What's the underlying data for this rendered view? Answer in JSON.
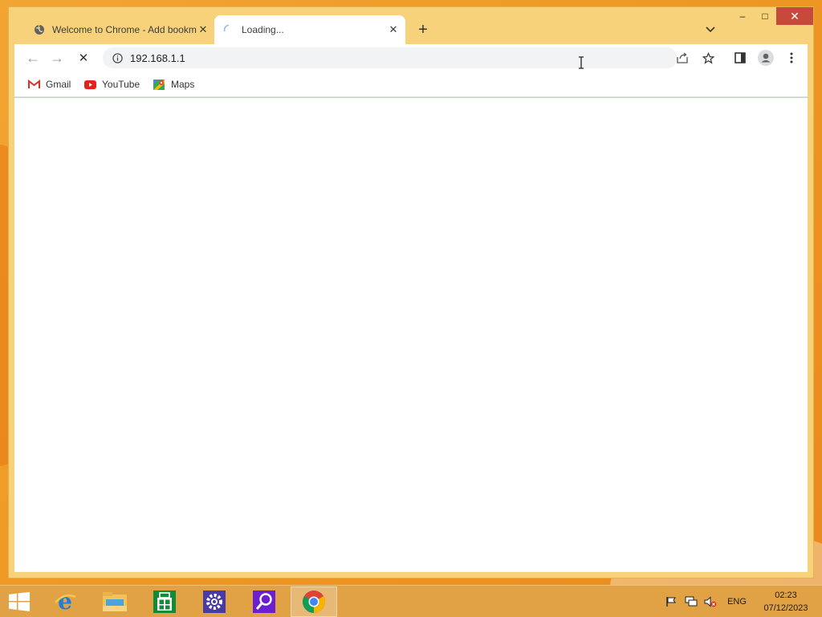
{
  "browser": {
    "tabs": [
      {
        "title": "Welcome to Chrome - Add bookmarks",
        "active": false,
        "favicon": "globe-icon"
      },
      {
        "title": "Loading...",
        "active": true,
        "favicon": "loading-spinner-icon"
      }
    ],
    "new_tab_icon": "+",
    "window_controls": {
      "minimize": "–",
      "maximize": "□",
      "close": "✕"
    }
  },
  "toolbar": {
    "back_icon": "←",
    "forward_icon": "→",
    "stop_icon": "✕",
    "url": "192.168.1.1"
  },
  "bookmarks": [
    {
      "label": "Gmail",
      "icon": "gmail-icon"
    },
    {
      "label": "YouTube",
      "icon": "youtube-icon"
    },
    {
      "label": "Maps",
      "icon": "maps-icon"
    }
  ],
  "taskbar": {
    "apps": [
      "internet-explorer",
      "file-explorer",
      "store",
      "settings",
      "search",
      "chrome"
    ],
    "language": "ENG",
    "time": "02:23",
    "date": "07/12/2023"
  },
  "colors": {
    "titlebar": "#f7d27a",
    "close_button": "#c7493b",
    "taskbar": "#e1a246"
  }
}
